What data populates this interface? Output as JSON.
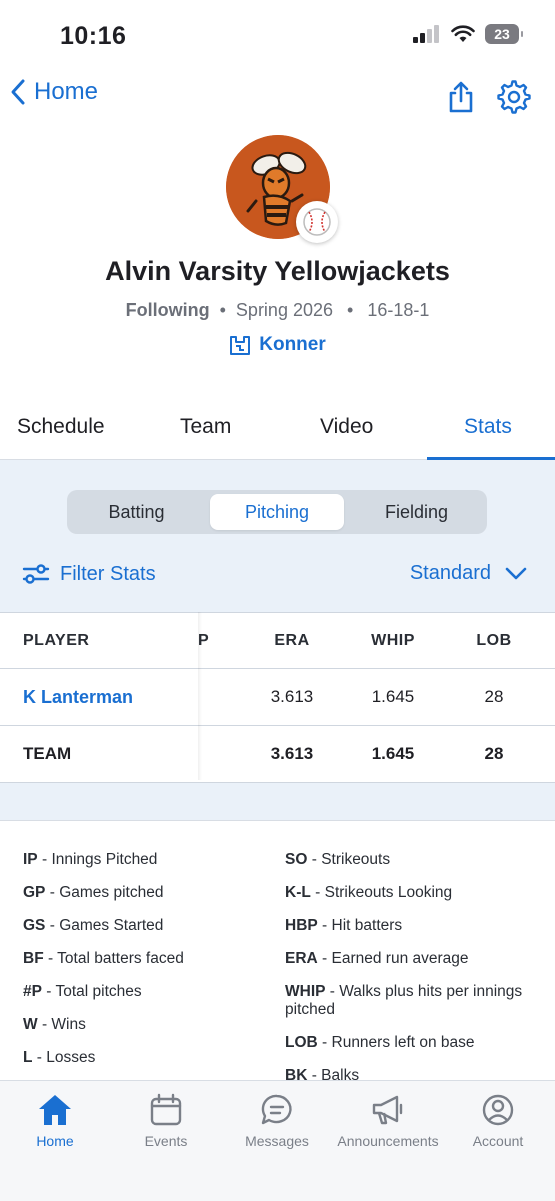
{
  "status": {
    "time": "10:16",
    "battery": "23"
  },
  "nav": {
    "back_label": "Home"
  },
  "team": {
    "name": "Alvin Varsity Yellowjackets",
    "following": "Following",
    "season": "Spring 2026",
    "record": "16-18-1",
    "user": "Konner"
  },
  "tabs": [
    "Schedule",
    "Team",
    "Video",
    "Stats"
  ],
  "active_tab": "Stats",
  "segments": [
    "Batting",
    "Pitching",
    "Fielding"
  ],
  "active_segment": "Pitching",
  "filter": {
    "label": "Filter Stats",
    "view": "Standard"
  },
  "table": {
    "headers": {
      "player": "PLAYER",
      "p": "P",
      "era": "ERA",
      "whip": "WHIP",
      "lob": "LOB"
    },
    "rows": [
      {
        "player": "K Lanterman",
        "era": "3.613",
        "whip": "1.645",
        "lob": "28"
      }
    ],
    "team": {
      "player": "TEAM",
      "era": "3.613",
      "whip": "1.645",
      "lob": "28"
    }
  },
  "legend_left": [
    {
      "abbr": "IP",
      "desc": "Innings Pitched"
    },
    {
      "abbr": "GP",
      "desc": "Games pitched"
    },
    {
      "abbr": "GS",
      "desc": "Games Started"
    },
    {
      "abbr": "BF",
      "desc": "Total batters faced"
    },
    {
      "abbr": "#P",
      "desc": "Total pitches"
    },
    {
      "abbr": "W",
      "desc": "Wins"
    },
    {
      "abbr": "L",
      "desc": "Losses"
    }
  ],
  "legend_right": [
    {
      "abbr": "SO",
      "desc": "Strikeouts"
    },
    {
      "abbr": "K-L",
      "desc": "Strikeouts Looking"
    },
    {
      "abbr": "HBP",
      "desc": "Hit batters"
    },
    {
      "abbr": "ERA",
      "desc": "Earned run average"
    },
    {
      "abbr": "WHIP",
      "desc": "Walks plus hits per innings pitched"
    },
    {
      "abbr": "LOB",
      "desc": "Runners left on base"
    },
    {
      "abbr": "BK",
      "desc": "Balks"
    }
  ],
  "tabbar": [
    {
      "label": "Home",
      "icon": "home-icon"
    },
    {
      "label": "Events",
      "icon": "calendar-icon"
    },
    {
      "label": "Messages",
      "icon": "chat-icon"
    },
    {
      "label": "Announcements",
      "icon": "megaphone-icon"
    },
    {
      "label": "Account",
      "icon": "user-icon"
    }
  ],
  "colors": {
    "accent": "#1a6fd1",
    "logo": "#c8571e",
    "stats_bg": "#eaf1f9"
  }
}
